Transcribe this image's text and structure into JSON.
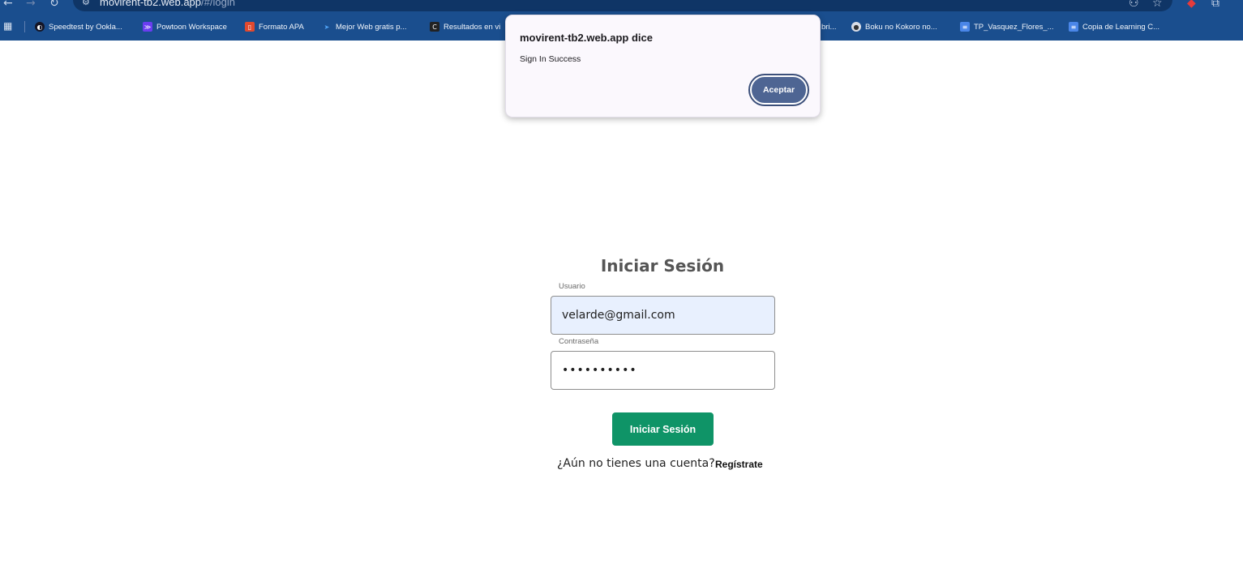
{
  "browser": {
    "url_host": "movirent-tb2.web.app",
    "url_path": "/#/login",
    "bookmarks": [
      {
        "label": "Speedtest by Ookla...",
        "icon": "speedtest-icon",
        "color": "#141526"
      },
      {
        "label": "Powtoon Workspace",
        "icon": "powtoon-icon",
        "color": "#6a3df0"
      },
      {
        "label": "Formato APA",
        "icon": "book-icon",
        "color": "#e0492f"
      },
      {
        "label": "Mejor Web gratis p...",
        "icon": "arrow-icon",
        "color": "#2f8ae6"
      },
      {
        "label": "Resultados en vi",
        "icon": "c-icon",
        "color": "#222222"
      },
      {
        "label": "bri...",
        "icon": "",
        "color": ""
      },
      {
        "label": "Boku no Kokoro no...",
        "icon": "chat-icon",
        "color": "#d9dde6"
      },
      {
        "label": "TP_Vasquez_Flores_...",
        "icon": "doc-icon",
        "color": "#4a86e8"
      },
      {
        "label": "Copia de Learning C...",
        "icon": "doc-icon",
        "color": "#4a86e8"
      }
    ]
  },
  "dialog": {
    "title": "movirent-tb2.web.app dice",
    "message": "Sign In Success",
    "accept_label": "Aceptar"
  },
  "login": {
    "title": "Iniciar Sesión",
    "username_label": "Usuario",
    "username_value": "velarde@gmail.com",
    "password_label": "Contraseña",
    "password_value": "••••••••••",
    "submit_label": "Iniciar Sesión",
    "signup_prompt": "¿Aún no tienes una cuenta?",
    "signup_link": "Regístrate"
  },
  "colors": {
    "chrome": "#1a4e8e",
    "submit": "#0f9467",
    "dialog_button": "#4e6593",
    "autofill": "#e8f0fe"
  }
}
